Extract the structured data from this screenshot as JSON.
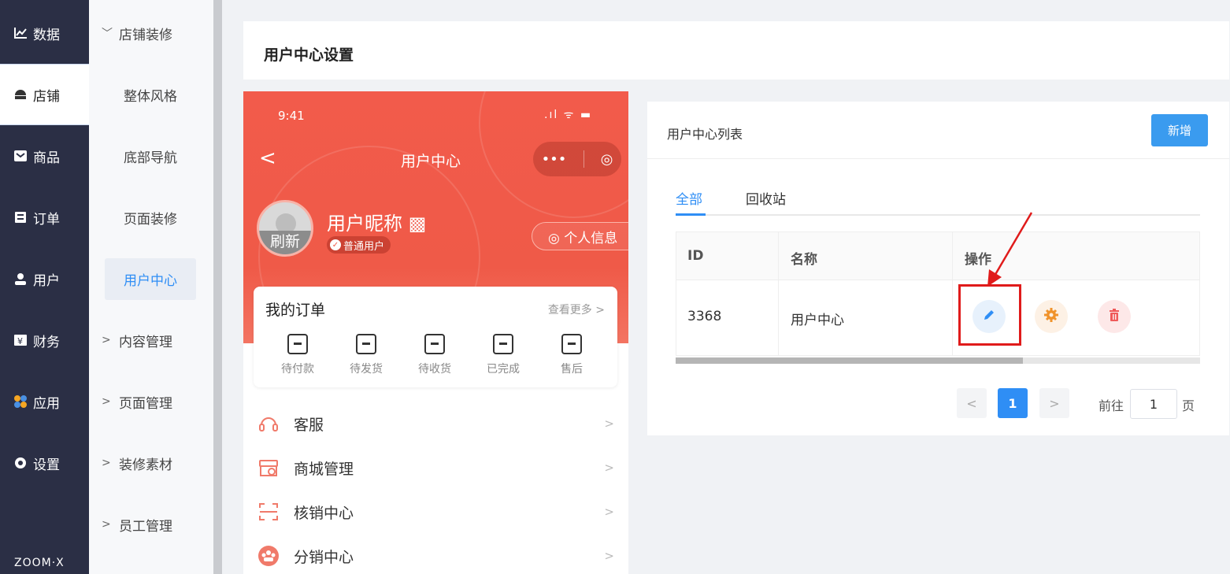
{
  "rail": {
    "items": [
      {
        "label": "数据",
        "icon": "chart-icon"
      },
      {
        "label": "店铺",
        "icon": "shop-icon"
      },
      {
        "label": "商品",
        "icon": "goods-icon"
      },
      {
        "label": "订单",
        "icon": "order-icon"
      },
      {
        "label": "用户",
        "icon": "user-icon"
      },
      {
        "label": "财务",
        "icon": "finance-icon"
      },
      {
        "label": "应用",
        "icon": "apps-icon"
      },
      {
        "label": "设置",
        "icon": "settings-icon"
      }
    ],
    "brand": "ZOOM·X"
  },
  "submenu": {
    "items": [
      {
        "label": "店铺装修",
        "arrow": "﹀"
      },
      {
        "label": "整体风格"
      },
      {
        "label": "底部导航"
      },
      {
        "label": "页面装修"
      },
      {
        "label": "用户中心"
      },
      {
        "label": "内容管理",
        "arrow": ">"
      },
      {
        "label": "页面管理",
        "arrow": ">"
      },
      {
        "label": "装修素材",
        "arrow": ">"
      },
      {
        "label": "员工管理",
        "arrow": ">"
      }
    ]
  },
  "page": {
    "title": "用户中心设置"
  },
  "phone": {
    "time": "9:41",
    "status": ".ıl ᯤ ▬",
    "back": "<",
    "title": "用户中心",
    "capsule_more": "•••",
    "capsule_close": "◎",
    "avatar_text": "刷新",
    "nickname": "用户昵称 ▩",
    "level": "普通用户",
    "profile_btn": "◎ 个人信息",
    "orders": {
      "title": "我的订单",
      "more": "查看更多 >",
      "items": [
        "待付款",
        "待发货",
        "待收货",
        "已完成",
        "售后"
      ]
    },
    "menu": [
      {
        "label": "客服",
        "chevron": ">"
      },
      {
        "label": "商城管理",
        "chevron": ">"
      },
      {
        "label": "核销中心",
        "chevron": ">"
      },
      {
        "label": "分销中心",
        "chevron": ">"
      }
    ]
  },
  "list": {
    "title": "用户中心列表",
    "add_label": "新增",
    "tabs": [
      "全部",
      "回收站"
    ],
    "columns": [
      "ID",
      "名称",
      "操作"
    ],
    "rows": [
      {
        "id": "3368",
        "name": "用户中心"
      }
    ],
    "pager": {
      "prev": "<",
      "current": "1",
      "next": ">",
      "goto_label": "前往",
      "goto_value": "1",
      "goto_suffix": "页"
    }
  },
  "colors": {
    "accent": "#2f8ef5",
    "phone_red": "#ef5a48",
    "highlight": "#e01b1b"
  }
}
